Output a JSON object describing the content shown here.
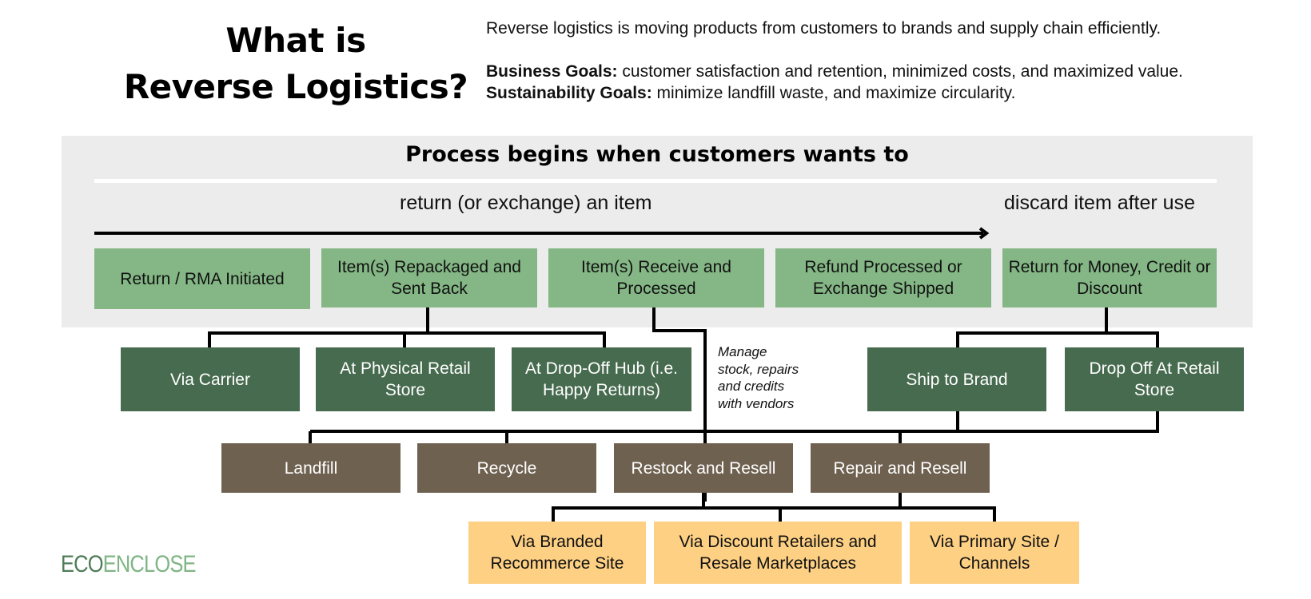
{
  "header": {
    "title_line1": "What is",
    "title_line2": "Reverse Logistics?",
    "definition": "Reverse logistics is moving products from customers to brands and supply chain efficiently.",
    "business_goals_label": "Business Goals:",
    "business_goals_text": " customer satisfaction and retention, minimized costs, and maximized value.",
    "sustainability_goals_label": "Sustainability Goals:",
    "sustainability_goals_text": " minimize landfill waste, and maximize circularity."
  },
  "process": {
    "title": "Process begins when customers wants to",
    "return_path_label": "return (or exchange) an item",
    "discard_path_label": "discard item after use",
    "steps": [
      "Return / RMA Initiated",
      "Item(s) Repackaged and Sent Back",
      "Item(s) Receive and Processed",
      "Refund Processed or Exchange Shipped",
      "Return for Money, Credit or Discount"
    ]
  },
  "return_methods": [
    "Via Carrier",
    "At Physical Retail Store",
    "At Drop-Off Hub (i.e. Happy Returns)"
  ],
  "discard_methods": [
    "Ship to Brand",
    "Drop Off At Retail Store"
  ],
  "vendor_note": [
    "Manage",
    "stock, repairs",
    "and credits",
    "with vendors"
  ],
  "outcomes": [
    "Landfill",
    "Recycle",
    "Restock and Resell",
    "Repair and Resell"
  ],
  "resale_channels": [
    "Via Branded Recommerce Site",
    "Via Discount Retailers and Resale Marketplaces",
    "Via Primary Site / Channels"
  ],
  "brand": {
    "logo_part1": "ECO",
    "logo_part2": "ENCLOSE"
  },
  "colors": {
    "step_green": "#84b785",
    "method_green": "#476b4f",
    "outcome_brown": "#6f6150",
    "channel_yellow": "#fdd084",
    "panel_gray": "#ececec"
  }
}
